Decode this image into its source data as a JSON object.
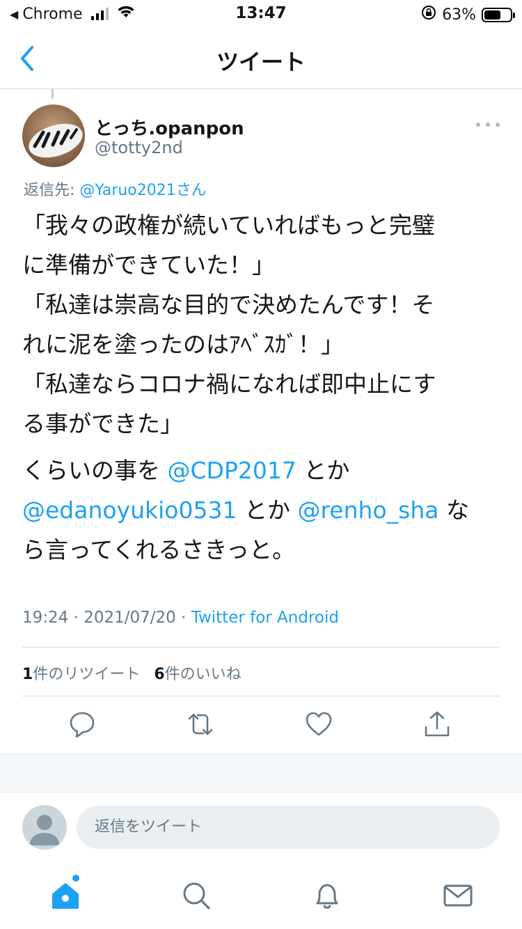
{
  "status_bar": {
    "carrier": "Chrome",
    "time": "13:47",
    "battery": "63%",
    "battery_level": 0.63
  },
  "nav": {
    "title": "ツイート"
  },
  "tweet": {
    "user_name": "とっち.opanpon",
    "user_handle": "@totty2nd",
    "reply_prefix": "返信先: ",
    "reply_to": "@Yaruo2021さん",
    "body_lines": [
      "「我々の政権が続いていればもっと完璧",
      "に準備ができていた！」",
      "「私達は崇高な目的で決めたんです！そ",
      "れに泥を塗ったのはｱﾍﾞｽｶﾞ！」",
      "「私達ならコロナ禍になれば即中止にす",
      "る事ができた」"
    ],
    "tail": {
      "p1_text": "くらいの事を ",
      "m1": "@CDP2017",
      "p1_tail": " とか",
      "m2": "@edanoyukio0531",
      "p2_mid": " とか ",
      "m3": "@renho_sha",
      "p2_tail": " な",
      "p3": "ら言ってくれるさきっと。"
    },
    "timestamp": "19:24 · 2021/07/20 · ",
    "source": "Twitter for Android",
    "retweet_count": "1",
    "retweet_label": "件のリツイート",
    "like_count": "6",
    "like_label": "件のいいね"
  },
  "reply": {
    "placeholder": "返信をツイート"
  },
  "icons": {
    "back": "chevron-left-icon",
    "more": "more-horizontal-icon",
    "reply": "reply-icon",
    "retweet": "retweet-icon",
    "like": "heart-icon",
    "share": "share-icon",
    "home": "home-icon",
    "search": "search-icon",
    "notifications": "bell-icon",
    "messages": "mail-icon"
  },
  "colors": {
    "accent": "#1da1f2",
    "secondary_text": "#657786",
    "divider": "#d6d9db"
  }
}
